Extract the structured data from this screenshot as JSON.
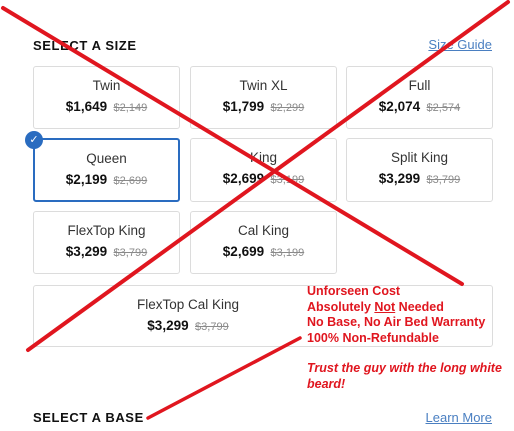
{
  "size_section": {
    "heading": "SELECT A SIZE",
    "guide_link": "Size Guide"
  },
  "sizes": [
    {
      "name": "Twin",
      "price": "$1,649",
      "was": "$2,149"
    },
    {
      "name": "Twin XL",
      "price": "$1,799",
      "was": "$2,299"
    },
    {
      "name": "Full",
      "price": "$2,074",
      "was": "$2,574"
    },
    {
      "name": "Queen",
      "price": "$2,199",
      "was": "$2,699",
      "selected": true
    },
    {
      "name": "King",
      "price": "$2,699",
      "was": "$3,199"
    },
    {
      "name": "Split King",
      "price": "$3,299",
      "was": "$3,799"
    },
    {
      "name": "FlexTop King",
      "price": "$3,299",
      "was": "$3,799"
    },
    {
      "name": "Cal King",
      "price": "$2,699",
      "was": "$3,199"
    },
    {
      "name": "FlexTop Cal King",
      "price": "$3,299",
      "was": "$3,799"
    }
  ],
  "base_section": {
    "heading": "SELECT A BASE",
    "learn_link": "Learn More"
  },
  "annotation": {
    "line1": "Unforseen Cost",
    "line2_prefix": "Absolutely ",
    "line2_emph": "Not",
    "line2_suffix": " Needed",
    "line3": "No Base, No Air Bed Warranty",
    "line4": "100% Non-Refundable",
    "quote": "Trust the guy with the long white beard!",
    "color": "#e0161f"
  },
  "icons": {
    "selected_check": "checkmark-icon"
  },
  "colors": {
    "accent": "#2a6cc0",
    "link": "#4a7fc1",
    "annotation": "#e0161f"
  }
}
